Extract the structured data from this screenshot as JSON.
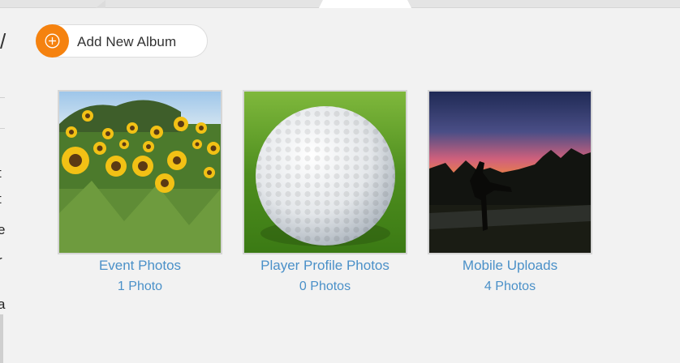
{
  "toolbar": {
    "add_album_label": "Add New Album",
    "add_icon": "plus-circle-icon",
    "accent_color": "#f5820f"
  },
  "albums": [
    {
      "title": "Event Photos",
      "count": "1 Photo",
      "thumbnail": "sunflower-field"
    },
    {
      "title": "Player Profile Photos",
      "count": "0 Photos",
      "thumbnail": "golf-ball"
    },
    {
      "title": "Mobile Uploads",
      "count": "4 Photos",
      "thumbnail": "sunset-silhouette"
    }
  ],
  "colors": {
    "link": "#4a90c8",
    "background": "#f2f2f2"
  },
  "left_cropped_text": [
    "t",
    "t",
    "e",
    "r",
    "a"
  ]
}
